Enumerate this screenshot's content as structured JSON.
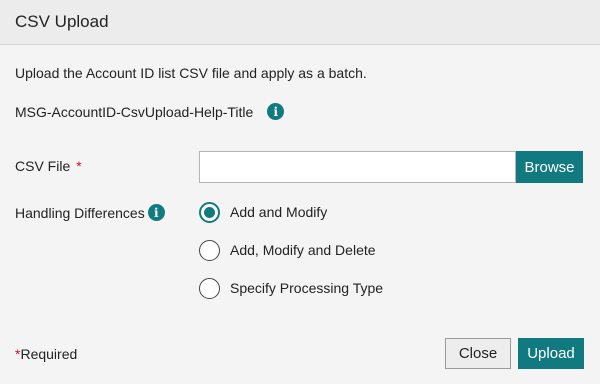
{
  "dialog": {
    "title": "CSV Upload",
    "description": "Upload the Account ID list CSV file and apply as a batch.",
    "help_title": "MSG-AccountID-CsvUpload-Help-Title",
    "info_icon": "i"
  },
  "csv_file": {
    "label": "CSV File",
    "required_mark": "*",
    "value": "",
    "browse_label": "Browse"
  },
  "handling": {
    "label": "Handling Differences",
    "options": [
      {
        "label": "Add and Modify",
        "selected": true
      },
      {
        "label": "Add, Modify and Delete",
        "selected": false
      },
      {
        "label": "Specify Processing Type",
        "selected": false
      }
    ]
  },
  "footer": {
    "required_star": "*",
    "required_text": "Required",
    "close_label": "Close",
    "upload_label": "Upload"
  },
  "colors": {
    "accent": "#117a80",
    "required": "#c8102e"
  }
}
